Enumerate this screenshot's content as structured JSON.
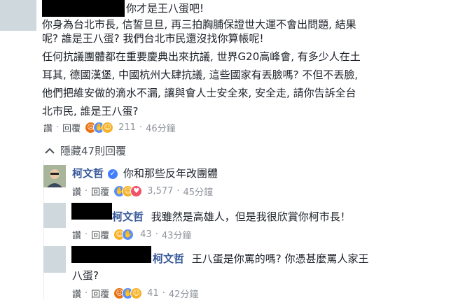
{
  "comment1": {
    "text_line1": "你才是王八蛋吧!",
    "body": [
      "你身為台北市長, 信誓旦旦, 再三拍胸脯保證世大運不會出問題, 結果",
      "呢? 誰是王八蛋? 我們台北市民還沒找你算帳呢!",
      "任何抗議團體都在重要慶典出來抗議, 世界G20高峰會, 有多少人在土",
      "耳其, 德國漢堡, 中國杭州大肆抗議, 這些國家有丟臉嗎? 不但不丟臉,",
      "他們把維安做的滴水不漏, 讓與會人士安全來, 安全走, 請你告訴全台",
      "北市民, 誰是王八蛋?"
    ],
    "like": "讚",
    "reply": "回覆",
    "reactions": [
      "angry",
      "like",
      "haha"
    ],
    "count": "211",
    "time": "46分鐘"
  },
  "replies_toggle": {
    "icon": "chevron-up-icon",
    "label": "隱藏47則回覆"
  },
  "reply1": {
    "name": "柯文哲",
    "text": "你和那些反年改團體",
    "like": "讚",
    "reply": "回覆",
    "reactions": [
      "like",
      "haha",
      "love"
    ],
    "count": "3,577",
    "time": "45分鐘"
  },
  "reply2": {
    "mention": "柯文哲",
    "text": "我雖然是高雄人，但是我很欣賞你柯市長！",
    "like": "讚",
    "reply": "回覆",
    "reactions": [
      "haha",
      "like"
    ],
    "count": "43",
    "time": "43分鐘"
  },
  "reply3": {
    "mention": "柯文哲",
    "text_line1": "王八蛋是你罵的嗎? 你憑甚麼罵人家王",
    "text_line2": "八蛋?",
    "like": "讚",
    "reply": "回覆",
    "reactions": [
      "angry",
      "like",
      "haha"
    ],
    "count": "41",
    "time": "42分鐘"
  },
  "colors": {
    "name_blue": "#365899",
    "meta_gray": "#90949c",
    "link_gray": "#4b4f56",
    "verified_blue": "#4080ff"
  }
}
